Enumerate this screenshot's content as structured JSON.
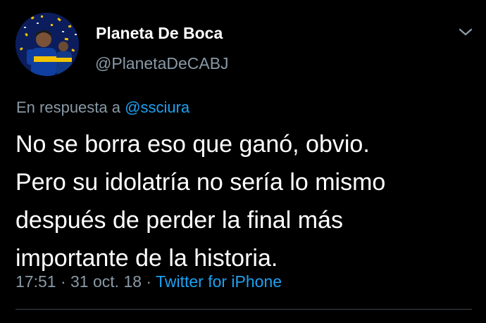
{
  "author": {
    "display_name": "Planeta De Boca",
    "handle": "@PlanetaDeCABJ",
    "avatar_icon": "boca-juniors-player-avatar"
  },
  "reply": {
    "prefix": "En respuesta a ",
    "mention": "@ssciura"
  },
  "tweet": {
    "text_lines": [
      "No se borra eso que ganó, obvio.",
      "Pero su idolatría no sería lo mismo",
      "después de perder la final más",
      "importante de la historia."
    ]
  },
  "meta": {
    "time": "17:51",
    "separator_1": " · ",
    "date": "31 oct. 18",
    "separator_2": " · ",
    "source": "Twitter for iPhone"
  },
  "menu": {
    "icon": "chevron-down-icon"
  },
  "colors": {
    "background": "#000000",
    "text": "#ffffff",
    "muted": "#8899a6",
    "link": "#1da1f2",
    "divider": "#38444d"
  }
}
